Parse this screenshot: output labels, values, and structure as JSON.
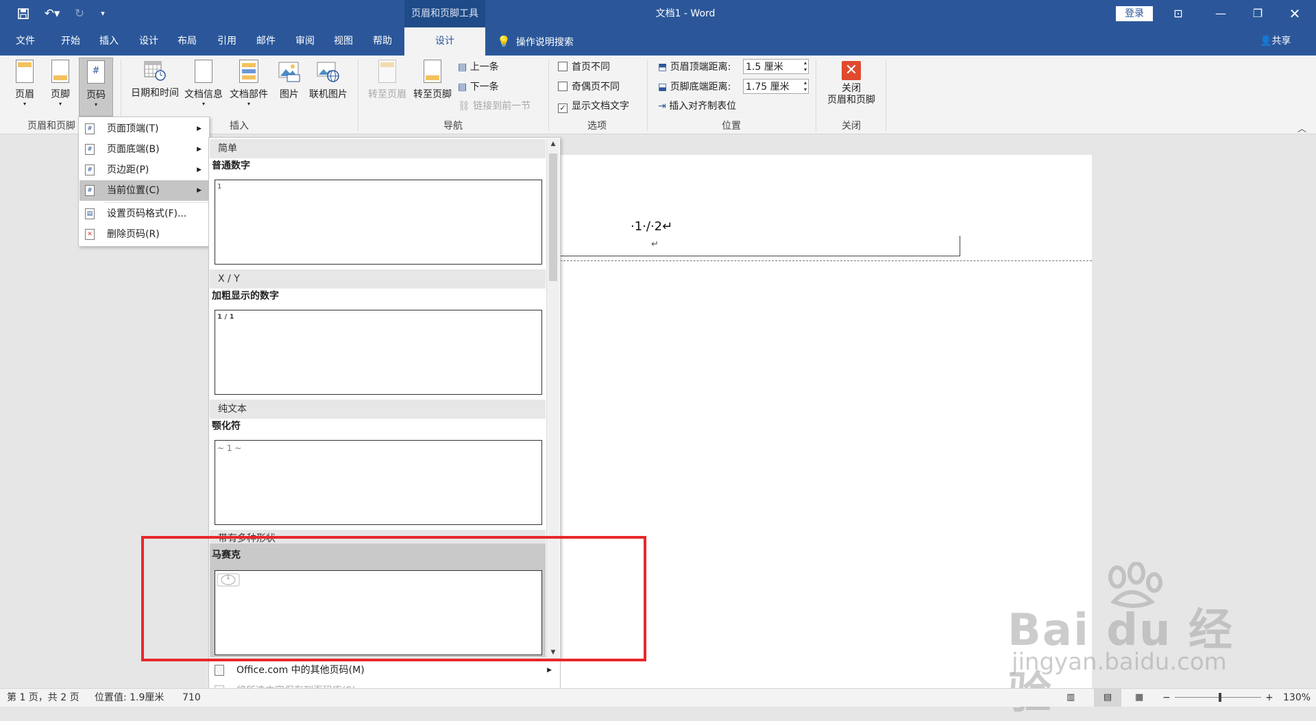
{
  "titlebar": {
    "context_tools": "页眉和页脚工具",
    "doc_title": "文档1  -  Word",
    "login": "登录",
    "icons": [
      "save-icon",
      "undo-icon",
      "redo-icon",
      "customize-qat-icon"
    ]
  },
  "tabs": [
    {
      "label": "文件"
    },
    {
      "label": "开始"
    },
    {
      "label": "插入"
    },
    {
      "label": "设计"
    },
    {
      "label": "布局"
    },
    {
      "label": "引用"
    },
    {
      "label": "邮件"
    },
    {
      "label": "审阅"
    },
    {
      "label": "视图"
    },
    {
      "label": "帮助"
    },
    {
      "label": "设计"
    }
  ],
  "tell_me": "操作说明搜索",
  "share": "共享",
  "ribbon": {
    "header": "页眉",
    "footer": "页脚",
    "page_number": "页码",
    "group_header_footer": "页眉和页脚",
    "datetime": "日期和时间",
    "docinfo": "文档信息",
    "quickparts": "文档部件",
    "picture": "图片",
    "online_picture": "联机图片",
    "group_insert": "插入",
    "goto_header": "转至页眉",
    "goto_footer": "转至页脚",
    "previous": "上一条",
    "next": "下一条",
    "link_previous": "链接到前一节",
    "group_navigation": "导航",
    "diff_first": "首页不同",
    "diff_odd_even": "奇偶页不同",
    "show_doc_text": "显示文档文字",
    "group_options": "选项",
    "header_from_top": "页眉顶端距离:",
    "header_from_top_value": "1.5 厘米",
    "footer_from_bottom": "页脚底端距离:",
    "footer_from_bottom_value": "1.75 厘米",
    "insert_align_tab": "插入对齐制表位",
    "group_position": "位置",
    "close_line1": "关闭",
    "close_line2": "页眉和页脚",
    "group_close": "关闭"
  },
  "page_number_menu": {
    "items": [
      {
        "label": "页面顶端(T)"
      },
      {
        "label": "页面底端(B)"
      },
      {
        "label": "页边距(P)"
      },
      {
        "label": "当前位置(C)"
      },
      {
        "label": "设置页码格式(F)..."
      },
      {
        "label": "删除页码(R)"
      }
    ]
  },
  "gallery": {
    "sections": [
      {
        "heading": "简单",
        "name": "普通数字",
        "preview": "1"
      },
      {
        "heading": "X / Y",
        "name": "加粗显示的数字",
        "preview": "1 / 1"
      },
      {
        "heading": "纯文本",
        "name": "颚化符",
        "preview": "~ 1 ~"
      },
      {
        "heading": "带有多种形状",
        "name": "马赛克",
        "preview": "1"
      }
    ],
    "footer_items": [
      {
        "label": "Office.com 中的其他页码(M)"
      },
      {
        "label": "将所选内容保存到页码库(S)..."
      }
    ]
  },
  "document": {
    "header_text": "·1·/·2↵",
    "return_mark": "↵"
  },
  "status": {
    "page": "第 1 页，共 2 页",
    "position": "位置值: 1.9厘米",
    "chars": "710",
    "zoom": "130%"
  },
  "watermark": {
    "big": "Bai du 经验",
    "small": "jingyan.baidu.com"
  },
  "colors": {
    "brand": "#2b579a",
    "annotation": "#e8282b"
  }
}
